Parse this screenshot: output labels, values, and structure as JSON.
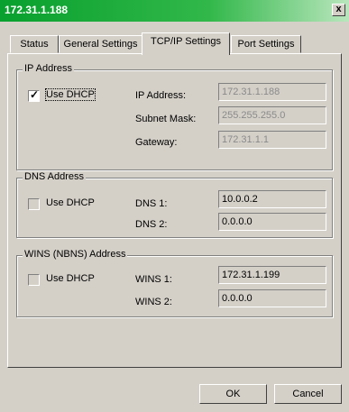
{
  "window": {
    "title": "172.31.1.188",
    "close_label": "x"
  },
  "tabs": [
    {
      "label": "Status"
    },
    {
      "label": "General Settings"
    },
    {
      "label": "TCP/IP Settings"
    },
    {
      "label": "Port Settings"
    }
  ],
  "ip_group": {
    "legend": "IP Address",
    "use_dhcp_label": "Use DHCP",
    "use_dhcp_checked": true,
    "ip_label": "IP Address:",
    "ip_value": "172.31.1.188",
    "mask_label": "Subnet Mask:",
    "mask_value": "255.255.255.0",
    "gateway_label": "Gateway:",
    "gateway_value": "172.31.1.1"
  },
  "dns_group": {
    "legend": "DNS Address",
    "use_dhcp_label": "Use DHCP",
    "dns1_label": "DNS 1:",
    "dns1_value": "10.0.0.2",
    "dns2_label": "DNS 2:",
    "dns2_value": "0.0.0.0"
  },
  "wins_group": {
    "legend": "WINS (NBNS) Address",
    "use_dhcp_label": "Use DHCP",
    "wins1_label": "WINS 1:",
    "wins1_value": "172.31.1.199",
    "wins2_label": "WINS 2:",
    "wins2_value": "0.0.0.0"
  },
  "buttons": {
    "ok": "OK",
    "cancel": "Cancel"
  }
}
